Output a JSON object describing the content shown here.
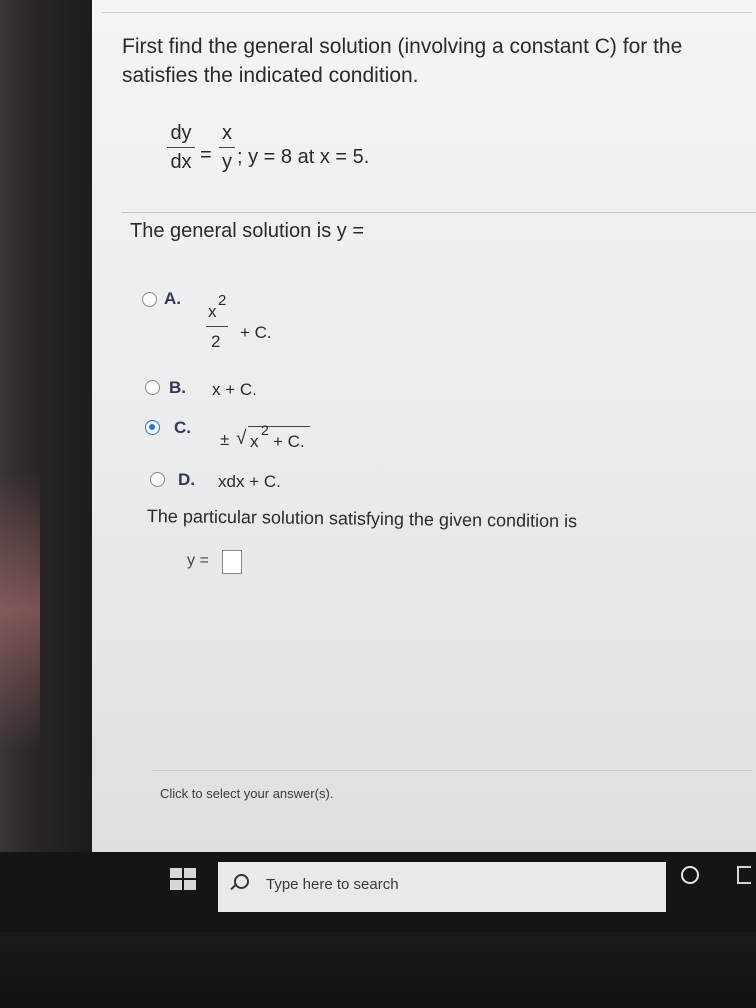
{
  "question": {
    "line1": "First find the general solution (involving a constant C) for the",
    "line2": "satisfies the indicated condition."
  },
  "equation": {
    "lhs_num": "dy",
    "lhs_den": "dx",
    "equals": "=",
    "rhs_num": "x",
    "rhs_den": "y",
    "condition": "; y = 8 at x = 5."
  },
  "general_label": "The general solution is y =",
  "options": [
    {
      "letter": "A.",
      "num": "x",
      "sup": "2",
      "den": "2",
      "tail": "+ C.",
      "selected": false
    },
    {
      "letter": "B.",
      "text": "x + C.",
      "selected": false
    },
    {
      "letter": "C.",
      "pre": "±",
      "radicand": "x",
      "sup": "2",
      "tail": "+ C.",
      "selected": true
    },
    {
      "letter": "D.",
      "text": "xdx + C.",
      "selected": false
    }
  ],
  "particular_label": "The particular solution satisfying the given condition is",
  "answer_prefix": "y =",
  "hint": "Click to select your answer(s).",
  "taskbar": {
    "search_placeholder": "Type here to search"
  }
}
